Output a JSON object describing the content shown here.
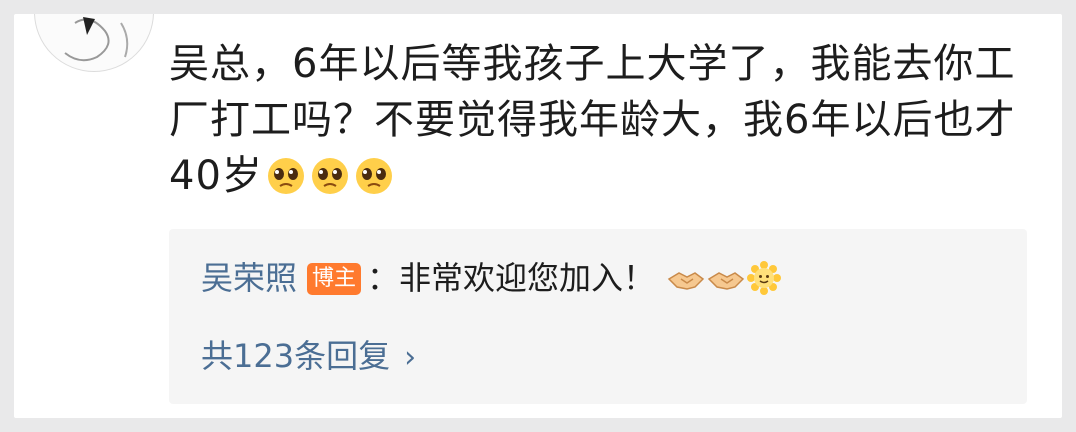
{
  "comment": {
    "text": "吴总，6年以后等我孩子上大学了，我能去你工厂打工吗？不要觉得我年龄大，我6年以后也才40岁",
    "emojis": [
      "pleading-face",
      "pleading-face",
      "pleading-face"
    ]
  },
  "reply": {
    "author": "吴荣照",
    "badge": "博主",
    "separator": "：",
    "text": "非常欢迎您加入！",
    "emojis": [
      "handshake",
      "handshake",
      "sun-face"
    ]
  },
  "more_replies": {
    "label": "共123条回复",
    "chevron": "›"
  },
  "colors": {
    "link": "#4b6e94",
    "badge": "#ff7a2e",
    "reply_bg": "#f5f5f5"
  }
}
